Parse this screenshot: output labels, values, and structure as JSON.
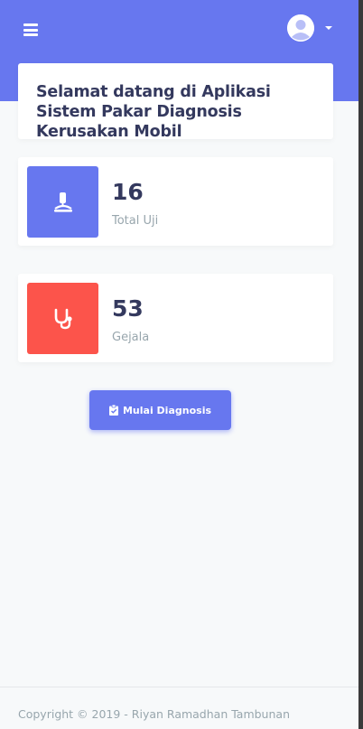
{
  "header": {
    "menu_icon": "hamburger-icon",
    "avatar_icon": "user-avatar-icon",
    "dropdown_icon": "caret-down-icon",
    "brand_color": "#6777ef"
  },
  "welcome": {
    "title": "Selamat datang di Aplikasi Sistem Pakar Diagnosis Kerusakan Mobil"
  },
  "stats": [
    {
      "value": "16",
      "label": "Total Uji",
      "icon": "microscope-icon",
      "color": "#6777ef"
    },
    {
      "value": "53",
      "label": "Gejala",
      "icon": "stethoscope-icon",
      "color": "#fc544b"
    }
  ],
  "action": {
    "label": "Mulai Diagnosis",
    "icon": "clipboard-check-icon"
  },
  "footer": {
    "copyright": "Copyright © 2019 - Riyan Ramadhan Tambunan"
  }
}
